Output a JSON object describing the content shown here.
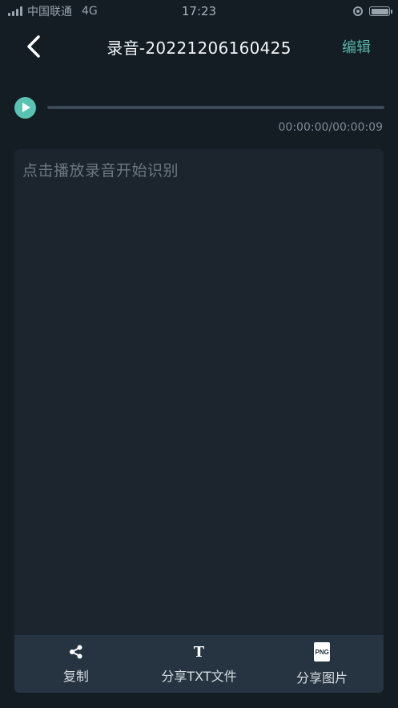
{
  "status_bar": {
    "carrier": "中国联通",
    "network": "4G",
    "time": "17:23",
    "battery_percent": 100
  },
  "nav": {
    "title": "录音-20221206160425",
    "edit_label": "编辑",
    "back_icon": "chevron-left-icon"
  },
  "player": {
    "time_readout": "00:00:00/00:00:09",
    "progress_percent": 0,
    "play_icon": "play-icon"
  },
  "transcript": {
    "placeholder": "点击播放录音开始识别"
  },
  "toolbar": {
    "items": [
      {
        "label": "复制",
        "icon": "share-icon"
      },
      {
        "label": "分享TXT文件",
        "icon": "text-t-icon"
      },
      {
        "label": "分享图片",
        "icon": "png-file-icon",
        "icon_text": "PNG"
      }
    ]
  },
  "colors": {
    "background": "#141c24",
    "accent": "#58c2b3",
    "edit_text": "#57b3a8",
    "panel": "#1c252e",
    "toolbar": "#263340"
  }
}
